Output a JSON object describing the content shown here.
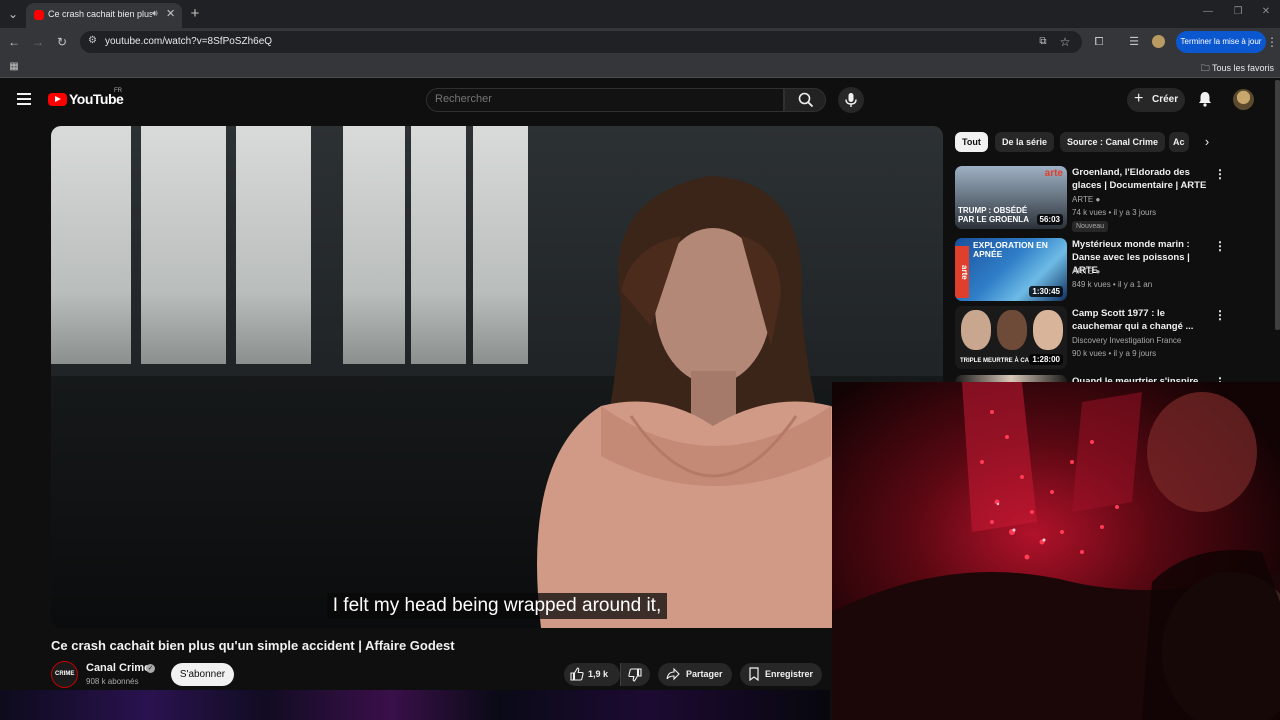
{
  "browser": {
    "tab_title": "Ce crash cachait bien plus q",
    "url": "youtube.com/watch?v=8SfPoSZh6eQ",
    "update_button": "Terminer la mise à jour",
    "bookmarks_label": "Tous les favoris"
  },
  "youtube": {
    "logo_text": "YouTube",
    "country_code": "FR",
    "search_placeholder": "Rechercher",
    "create_label": "Créer"
  },
  "video": {
    "subtitle": "I felt my head being wrapped around it,",
    "title": "Ce crash cachait bien plus qu'un simple accident | Affaire Godest",
    "channel_name": "Canal Crime",
    "channel_avatar_text": "CRIME",
    "subscribers": "908 k abonnés",
    "subscribe_label": "S'abonner",
    "likes": "1,9 k",
    "share_label": "Partager",
    "save_label": "Enregistrer"
  },
  "sidebar": {
    "chips": [
      "Tout",
      "De la série",
      "Source : Canal Crime",
      "Ac"
    ],
    "recommendations": [
      {
        "title": "Groenland, l'Eldorado des glaces | Documentaire | ARTE",
        "channel": "ARTE",
        "meta": "74 k vues • il y a 3 jours",
        "duration": "56:03",
        "badge": "Nouveau",
        "thumb_text": "TRUMP : OBSÉDÉ PAR LE GROENLA",
        "thumb_brand": "arte"
      },
      {
        "title": "Mystérieux monde marin : Danse avec les poissons | ARTE",
        "channel": "ARTE",
        "meta": "849 k vues • il y a 1 an",
        "duration": "1:30:45",
        "thumb_text": "EXPLORATION EN APNÉE",
        "thumb_brand": "arte"
      },
      {
        "title": "Camp Scott 1977 : le cauchemar qui a changé ...",
        "channel": "Discovery Investigation France",
        "meta": "90 k vues • il y a 9 jours",
        "duration": "1:28:00",
        "thumb_text": "TRIPLE MEURTRE À CA"
      },
      {
        "title": "Quand le meurtrier s'inspire de"
      }
    ]
  },
  "colors": {
    "youtube_red": "#ff0000",
    "chrome_blue": "#0b57d0",
    "background": "#0f0f0f"
  }
}
